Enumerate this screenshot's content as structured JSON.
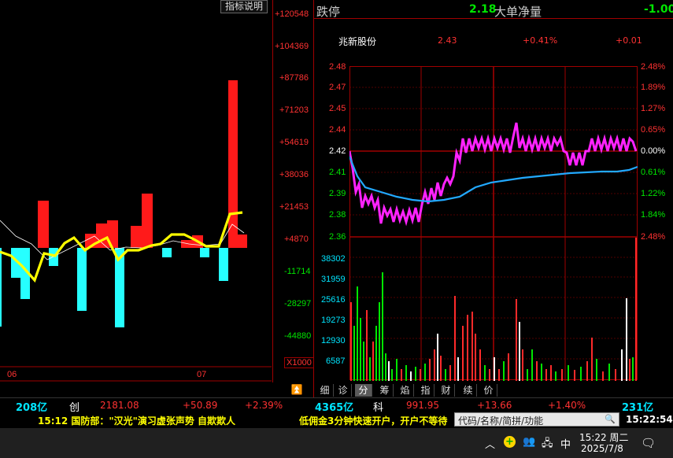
{
  "left_panel": {
    "indicator_button": "指标说明",
    "y_axis_labels": [
      "+120548",
      "+104369",
      "+87786",
      "+71203",
      "+54619",
      "+38036",
      "+21453",
      "+4870",
      "-11714",
      "-28297",
      "-44880"
    ],
    "multiplier": "X1000",
    "x_labels": [
      "06",
      "07"
    ]
  },
  "top_right": {
    "status": "跌停",
    "price": "2.18",
    "label": "大单净量",
    "value": "-1.00"
  },
  "stock_header": {
    "name": "兆新股份",
    "price": "2.43",
    "change_pct": "+0.41%",
    "change": "+0.01"
  },
  "price_axis": [
    "2.48",
    "2.47",
    "2.45",
    "2.44",
    "2.42",
    "2.41",
    "2.39",
    "2.38",
    "2.36"
  ],
  "pct_axis": [
    "2.48%",
    "1.89%",
    "1.27%",
    "0.65%",
    "0.00%",
    "0.61%",
    "1.22%",
    "1.84%",
    "2.48%"
  ],
  "volume_axis": [
    "38302",
    "31959",
    "25616",
    "19273",
    "12930",
    "6587"
  ],
  "tabs": [
    "细",
    "诊",
    "分",
    "筹",
    "焰",
    "指",
    "财",
    "续",
    "价"
  ],
  "active_tab": "分",
  "index_bar": {
    "left_amount": "208亿",
    "chuang_label": "创",
    "chuang_value": "2181.08",
    "chuang_change": "+50.89",
    "chuang_pct": "+2.39%",
    "mid_amount": "4365亿",
    "ke_label": "科",
    "ke_value": "991.95",
    "ke_change": "+13.66",
    "ke_pct": "+1.40%",
    "right_amount": "231亿"
  },
  "news_ticker": {
    "headline": "15:12 国防部：\"汉光\"演习虚张声势 自欺欺人",
    "ad": "低佣金3分钟快速开户，开户不等待"
  },
  "search_input": {
    "placeholder": "代码/名称/简拼/功能"
  },
  "clock": "15:22:54",
  "taskbar": {
    "ime": "中",
    "time": "15:22 周二",
    "date": "2025/7/8"
  }
}
